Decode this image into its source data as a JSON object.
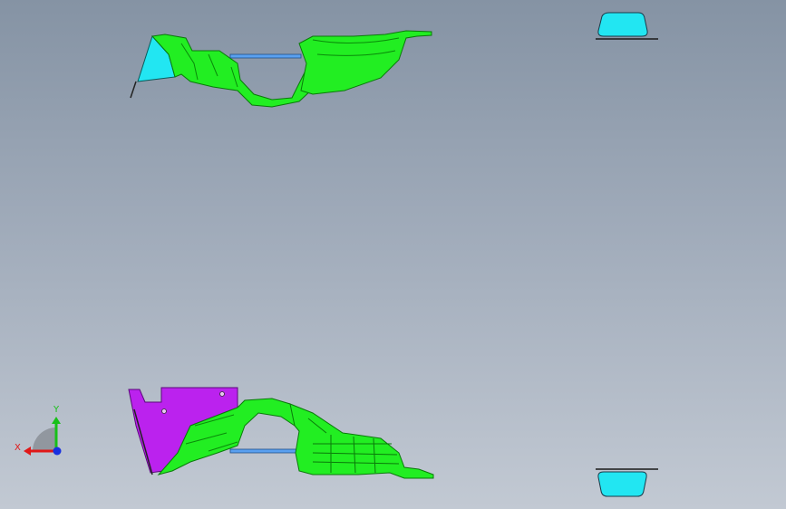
{
  "viewport": {
    "background_top": "#8593a4",
    "background_bottom": "#c2c9d3"
  },
  "parts": {
    "green": "#22ee22",
    "green_dark": "#0a8a0a",
    "cyan": "#22e6f2",
    "magenta": "#bb22ee",
    "blue_link": "#5aa0f0"
  },
  "triad": {
    "x_label": "X",
    "y_label": "Y",
    "x_color": "#e01818",
    "y_color": "#18c018",
    "z_color": "#1830e0"
  }
}
